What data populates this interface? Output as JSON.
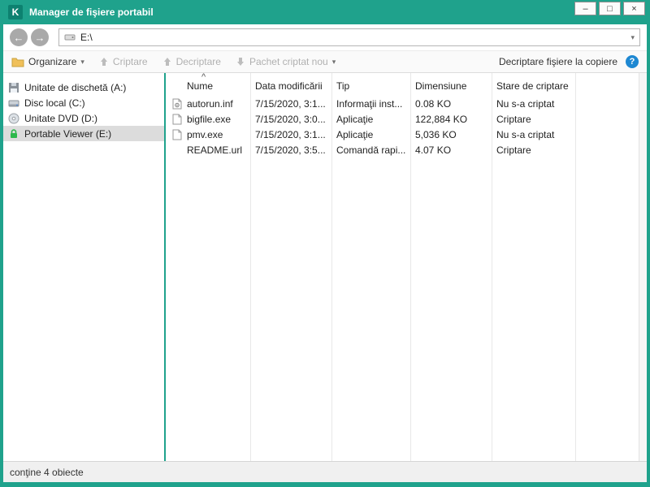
{
  "window": {
    "title": "Manager de fişiere portabil",
    "controls": {
      "minimize": "–",
      "maximize": "□",
      "close": "×"
    },
    "logo_letter": "K",
    "brand_color": "#1fa28c"
  },
  "icons": {
    "back": "←",
    "forward": "→",
    "dropdown": "▾",
    "sort_asc": "^",
    "help": "?"
  },
  "nav": {
    "address": "E:\\"
  },
  "toolbar": {
    "organize": "Organizare",
    "encrypt": "Criptare",
    "decrypt": "Decriptare",
    "new_package": "Pachet criptat nou",
    "decrypt_on_copy": "Decriptare fişiere la copiere"
  },
  "sidebar": {
    "items": [
      {
        "label": "Unitate de dischetă (A:)",
        "icon": "floppy-icon",
        "selected": false
      },
      {
        "label": "Disc local (C:)",
        "icon": "hard-disk-icon",
        "selected": false
      },
      {
        "label": "Unitate DVD (D:)",
        "icon": "dvd-icon",
        "selected": false
      },
      {
        "label": "Portable Viewer (E:)",
        "icon": "lock-icon",
        "selected": true
      }
    ]
  },
  "filelist": {
    "columns": [
      "Nume",
      "Data modificării",
      "Tip",
      "Dimensiune",
      "Stare de criptare"
    ],
    "rows": [
      {
        "name": "autorun.inf",
        "icon": "setup-file-icon",
        "date": "7/15/2020, 3:1...",
        "type": "Informaţii inst...",
        "size": "0.08 KO",
        "status": "Nu s-a criptat"
      },
      {
        "name": "bigfile.exe",
        "icon": "file-icon",
        "date": "7/15/2020, 3:0...",
        "type": "Aplicaţie",
        "size": "122,884 KO",
        "status": "Criptare"
      },
      {
        "name": "pmv.exe",
        "icon": "file-icon",
        "date": "7/15/2020, 3:1...",
        "type": "Aplicaţie",
        "size": "5,036 KO",
        "status": "Nu s-a criptat"
      },
      {
        "name": "README.url",
        "icon": "shortcut-file-icon",
        "date": "7/15/2020, 3:5...",
        "type": "Comandă rapi...",
        "size": "4.07 KO",
        "status": "Criptare"
      }
    ]
  },
  "statusbar": {
    "text": "conţine 4 obiecte"
  }
}
